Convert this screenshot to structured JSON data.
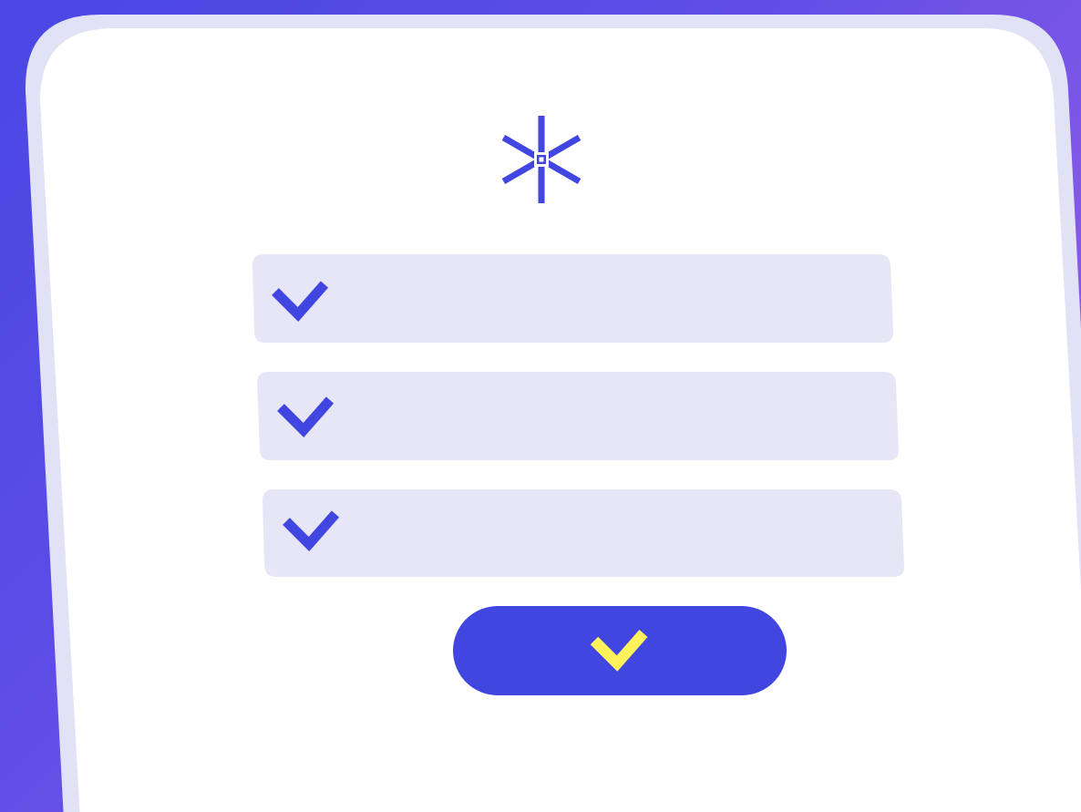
{
  "theme": {
    "background_start": "#4A47E3",
    "background_end": "#A866E6",
    "card_fill": "#FFFFFF",
    "card_border": "#E2E2F7",
    "field_fill": "#E6E6F6",
    "accent": "#4246E0",
    "button_check": "#FFF25A"
  },
  "logo": {
    "icon": "asterisk-logo-icon"
  },
  "fields": [
    {
      "icon": "check-icon",
      "checked": true
    },
    {
      "icon": "check-icon",
      "checked": true
    },
    {
      "icon": "check-icon",
      "checked": true
    }
  ],
  "submit": {
    "icon": "check-icon"
  }
}
